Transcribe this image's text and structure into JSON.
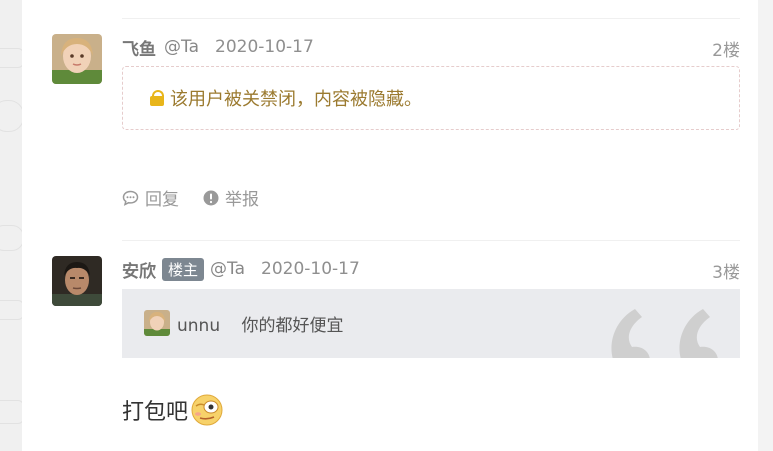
{
  "comments": [
    {
      "user": "飞鱼",
      "handle": "@Ta",
      "date": "2020-10-17",
      "floor": "2楼",
      "notice_text": "该用户被关禁闭，内容被隐藏。",
      "actions": {
        "reply": "回复",
        "report": "举报"
      }
    },
    {
      "user": "安欣",
      "badge": "楼主",
      "handle": "@Ta",
      "date": "2020-10-17",
      "floor": "3楼",
      "quote": {
        "user": "unnu",
        "text": "你的都好便宜"
      },
      "content": "打包吧",
      "emoji": "dizzy-face-emoji"
    }
  ],
  "colors": {
    "notice_border": "#e6cccc",
    "lock": "#e8b51a",
    "badge_bg": "#7d8791",
    "quote_bg": "#eaebee"
  }
}
